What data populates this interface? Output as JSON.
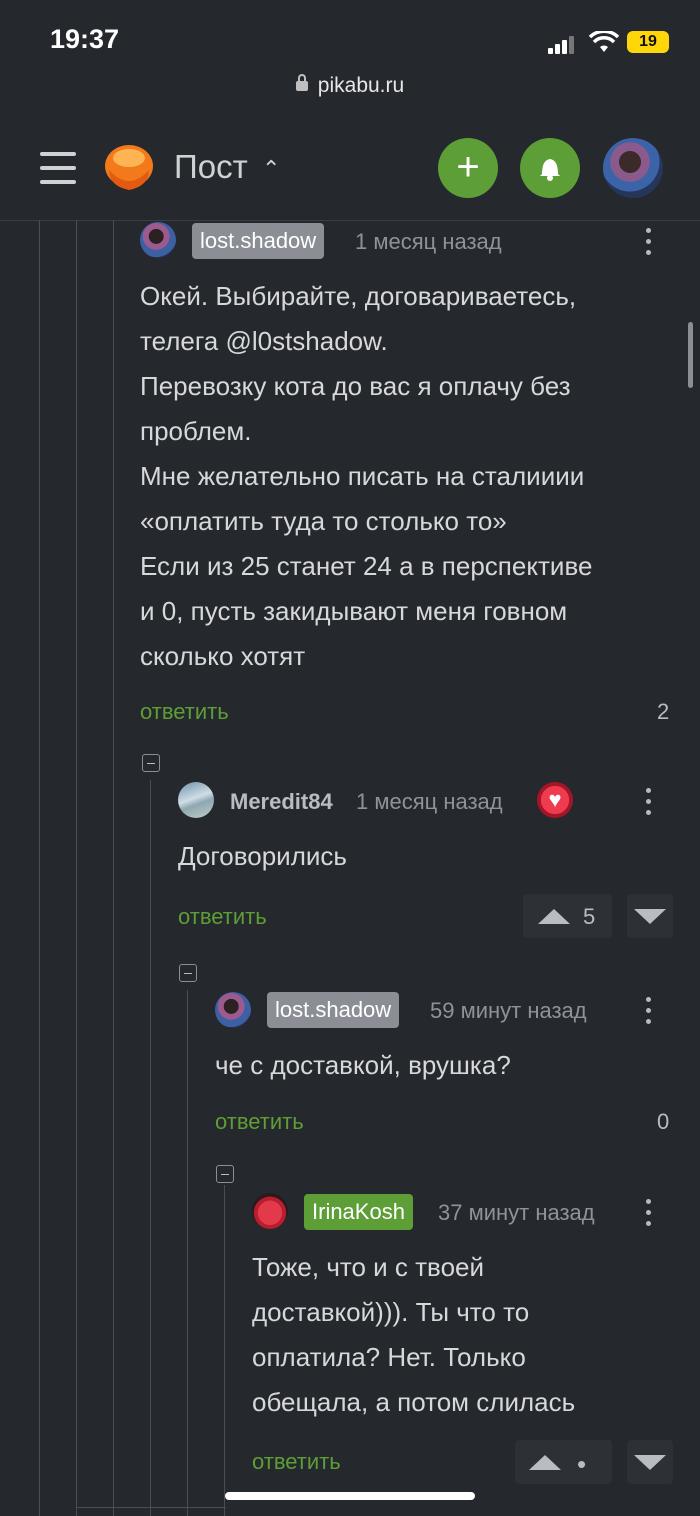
{
  "status_bar": {
    "time": "19:37",
    "battery": "19"
  },
  "browser": {
    "url": "pikabu.ru"
  },
  "header": {
    "title": "Пост",
    "add_label": "+"
  },
  "comments": [
    {
      "author": "lost.shadow",
      "time": "1 месяц назад",
      "lines": [
        "Окей. Выбирайте, договариваетесь,",
        "телега @l0stshadow.",
        "Перевозку кота до вас я оплачу без",
        "проблем.",
        "Мне желательно писать на сталииии",
        "«оплатить туда то столько то»",
        "Если из 25 станет 24 а в перспективе",
        "и 0, пусть закидывают меня говном",
        "сколько хотят"
      ],
      "reply_label": "ответить",
      "rating": "2"
    },
    {
      "author": "Meredit84",
      "time": "1 месяц назад",
      "lines": [
        "Договорились"
      ],
      "reply_label": "ответить",
      "rating": "5"
    },
    {
      "author": "lost.shadow",
      "time": "59 минут назад",
      "lines": [
        "че с доставкой, врушка?"
      ],
      "reply_label": "ответить",
      "rating": "0"
    },
    {
      "author": "IrinaKosh",
      "time": "37 минут назад",
      "lines": [
        "Тоже, что и с твоей",
        "доставкой))). Ты что то",
        "оплатила? Нет. Только",
        "обещала, а потом слилась"
      ],
      "reply_label": "ответить",
      "rating": "•"
    }
  ],
  "colors": {
    "accent": "#5e9e36",
    "background": "#25282c",
    "author_badge": "#8b8f95"
  }
}
